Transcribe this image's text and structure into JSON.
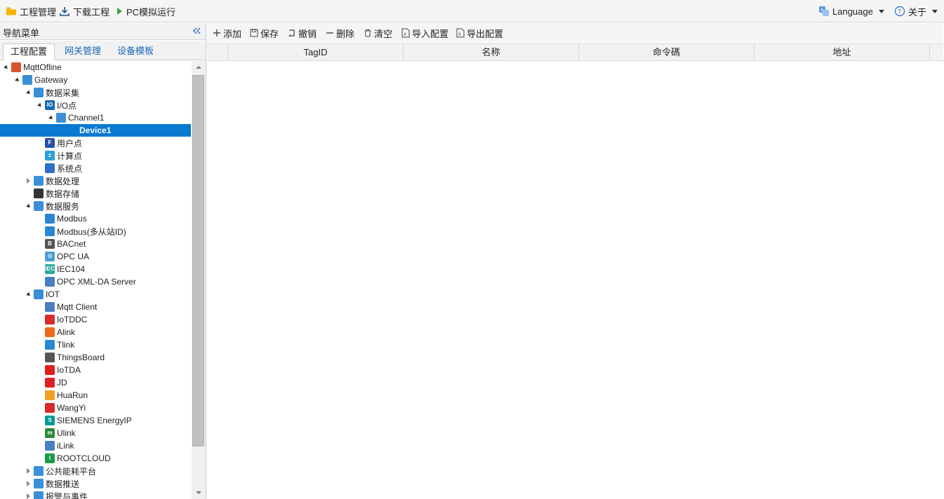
{
  "topbar": {
    "project_mgmt": "工程管理",
    "download_project": "下载工程",
    "pc_sim_run": "PC模拟运行",
    "language": "Language",
    "about": "关于"
  },
  "nav": {
    "title": "导航菜单",
    "tabs": [
      "工程配置",
      "网关管理",
      "设备模板"
    ],
    "tree": [
      {
        "label": "MqttOfline",
        "depth": 0,
        "toggle": "open",
        "icon": "layers-icon",
        "color": "#d9532c",
        "glyph": ""
      },
      {
        "label": "Gateway",
        "depth": 1,
        "toggle": "open",
        "icon": "gateway-icon",
        "color": "#3b8fd8",
        "glyph": ""
      },
      {
        "label": "数据采集",
        "depth": 2,
        "toggle": "open",
        "icon": "chart-icon",
        "color": "#3b8fd8",
        "glyph": ""
      },
      {
        "label": "I/O点",
        "depth": 3,
        "toggle": "open",
        "icon": "io-icon",
        "color": "#1668b5",
        "glyph": "IO"
      },
      {
        "label": "Channel1",
        "depth": 4,
        "toggle": "open",
        "icon": "network-icon",
        "color": "#3b8fd8",
        "glyph": ""
      },
      {
        "label": "Device1",
        "depth": 5,
        "toggle": "none",
        "icon": "device-icon",
        "color": "#0a7ad1",
        "glyph": "",
        "selected": true
      },
      {
        "label": "用户点",
        "depth": 3,
        "toggle": "none",
        "icon": "user-point-icon",
        "color": "#2c4fa8",
        "glyph": "F"
      },
      {
        "label": "计算点",
        "depth": 3,
        "toggle": "none",
        "icon": "calculator-icon",
        "color": "#2aa1d8",
        "glyph": "±"
      },
      {
        "label": "系统点",
        "depth": 3,
        "toggle": "none",
        "icon": "monitor-icon",
        "color": "#2c6fc8",
        "glyph": ""
      },
      {
        "label": "数据处理",
        "depth": 2,
        "toggle": "closed",
        "icon": "wave-icon",
        "color": "#3b8fd8",
        "glyph": ""
      },
      {
        "label": "数据存储",
        "depth": 2,
        "toggle": "none",
        "icon": "database-icon",
        "color": "#333333",
        "glyph": ""
      },
      {
        "label": "数据服务",
        "depth": 2,
        "toggle": "open",
        "icon": "exchange-icon",
        "color": "#3b8fd8",
        "glyph": ""
      },
      {
        "label": "Modbus",
        "depth": 3,
        "toggle": "none",
        "icon": "modbus-icon",
        "color": "#2a86d1",
        "glyph": ""
      },
      {
        "label": "Modbus(多从站ID)",
        "depth": 3,
        "toggle": "none",
        "icon": "modbus-icon",
        "color": "#2a86d1",
        "glyph": ""
      },
      {
        "label": "BACnet",
        "depth": 3,
        "toggle": "none",
        "icon": "bacnet-icon",
        "color": "#555555",
        "glyph": "B"
      },
      {
        "label": "OPC UA",
        "depth": 3,
        "toggle": "none",
        "icon": "opc-ua-icon",
        "color": "#4a9bd6",
        "glyph": "⚙"
      },
      {
        "label": "IEC104",
        "depth": 3,
        "toggle": "none",
        "icon": "iec-icon",
        "color": "#29a8a0",
        "glyph": "IEC"
      },
      {
        "label": "OPC XML-DA Server",
        "depth": 3,
        "toggle": "none",
        "icon": "opc-xml-icon",
        "color": "#4a7fc1",
        "glyph": ""
      },
      {
        "label": "IOT",
        "depth": 2,
        "toggle": "open",
        "icon": "iot-icon",
        "color": "#3b8fd8",
        "glyph": ""
      },
      {
        "label": "Mqtt Client",
        "depth": 3,
        "toggle": "none",
        "icon": "mqtt-icon",
        "color": "#4a7fc1",
        "glyph": ""
      },
      {
        "label": "IoTDDC",
        "depth": 3,
        "toggle": "none",
        "icon": "iotddc-icon",
        "color": "#d92b2b",
        "glyph": ""
      },
      {
        "label": "Alink",
        "depth": 3,
        "toggle": "none",
        "icon": "alink-icon",
        "color": "#f06a1a",
        "glyph": ""
      },
      {
        "label": "Tlink",
        "depth": 3,
        "toggle": "none",
        "icon": "tlink-icon",
        "color": "#2a86d1",
        "glyph": ""
      },
      {
        "label": "ThingsBoard",
        "depth": 3,
        "toggle": "none",
        "icon": "thingsboard-icon",
        "color": "#555555",
        "glyph": ""
      },
      {
        "label": "IoTDA",
        "depth": 3,
        "toggle": "none",
        "icon": "huawei-icon",
        "color": "#e02020",
        "glyph": ""
      },
      {
        "label": "JD",
        "depth": 3,
        "toggle": "none",
        "icon": "jd-icon",
        "color": "#e02020",
        "glyph": ""
      },
      {
        "label": "HuaRun",
        "depth": 3,
        "toggle": "none",
        "icon": "huarun-icon",
        "color": "#f0a020",
        "glyph": ""
      },
      {
        "label": "WangYi",
        "depth": 3,
        "toggle": "none",
        "icon": "wangyi-icon",
        "color": "#d92b2b",
        "glyph": ""
      },
      {
        "label": "SIEMENS EnergyIP",
        "depth": 3,
        "toggle": "none",
        "icon": "siemens-icon",
        "color": "#009999",
        "glyph": "S"
      },
      {
        "label": "Ulink",
        "depth": 3,
        "toggle": "none",
        "icon": "ulink-icon",
        "color": "#2a8a3a",
        "glyph": "m"
      },
      {
        "label": "iLink",
        "depth": 3,
        "toggle": "none",
        "icon": "ilink-icon",
        "color": "#4a7fc1",
        "glyph": ""
      },
      {
        "label": "ROOTCLOUD",
        "depth": 3,
        "toggle": "none",
        "icon": "rootcloud-icon",
        "color": "#1a9a4a",
        "glyph": "I"
      },
      {
        "label": "公共能耗平台",
        "depth": 2,
        "toggle": "closed",
        "icon": "bar-chart-icon",
        "color": "#3b8fd8",
        "glyph": ""
      },
      {
        "label": "数据推送",
        "depth": 2,
        "toggle": "closed",
        "icon": "send-icon",
        "color": "#3b8fd8",
        "glyph": ""
      },
      {
        "label": "报警与事件",
        "depth": 2,
        "toggle": "closed",
        "icon": "alarm-icon",
        "color": "#3b8fd8",
        "glyph": ""
      }
    ]
  },
  "toolbar": {
    "add": "添加",
    "save": "保存",
    "undo": "撤销",
    "delete": "删除",
    "clear": "清空",
    "import": "导入配置",
    "export": "导出配置"
  },
  "grid": {
    "columns": [
      "TagID",
      "名称",
      "命令碼",
      "地址"
    ]
  }
}
